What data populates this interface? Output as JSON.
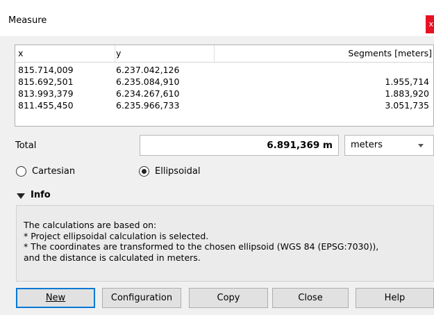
{
  "window": {
    "title": "Measure",
    "close_glyph": "x"
  },
  "table": {
    "headers": {
      "x": "x",
      "y": "y",
      "segments": "Segments [meters]"
    },
    "rows": [
      {
        "x": "815.714,009",
        "y": "6.237.042,126",
        "segment": ""
      },
      {
        "x": "815.692,501",
        "y": "6.235.084,910",
        "segment": "1.955,714"
      },
      {
        "x": "813.993,379",
        "y": "6.234.267,610",
        "segment": "1.883,920"
      },
      {
        "x": "811.455,450",
        "y": "6.235.966,733",
        "segment": "3.051,735"
      }
    ]
  },
  "total": {
    "label": "Total",
    "value": "6.891,369 m",
    "unit": "meters"
  },
  "mode": {
    "options": [
      {
        "label": "Cartesian",
        "checked": false
      },
      {
        "label": "Ellipsoidal",
        "checked": true
      }
    ]
  },
  "info": {
    "header": "Info",
    "lines": [
      "The calculations are based on:",
      "* Project ellipsoidal calculation is selected.",
      "* The coordinates are transformed to the chosen ellipsoid (WGS 84 (EPSG:7030)),",
      "and the distance is calculated in meters."
    ]
  },
  "buttons": {
    "new": "New",
    "configuration": "Configuration",
    "copy": "Copy",
    "close": "Close",
    "help": "Help"
  }
}
